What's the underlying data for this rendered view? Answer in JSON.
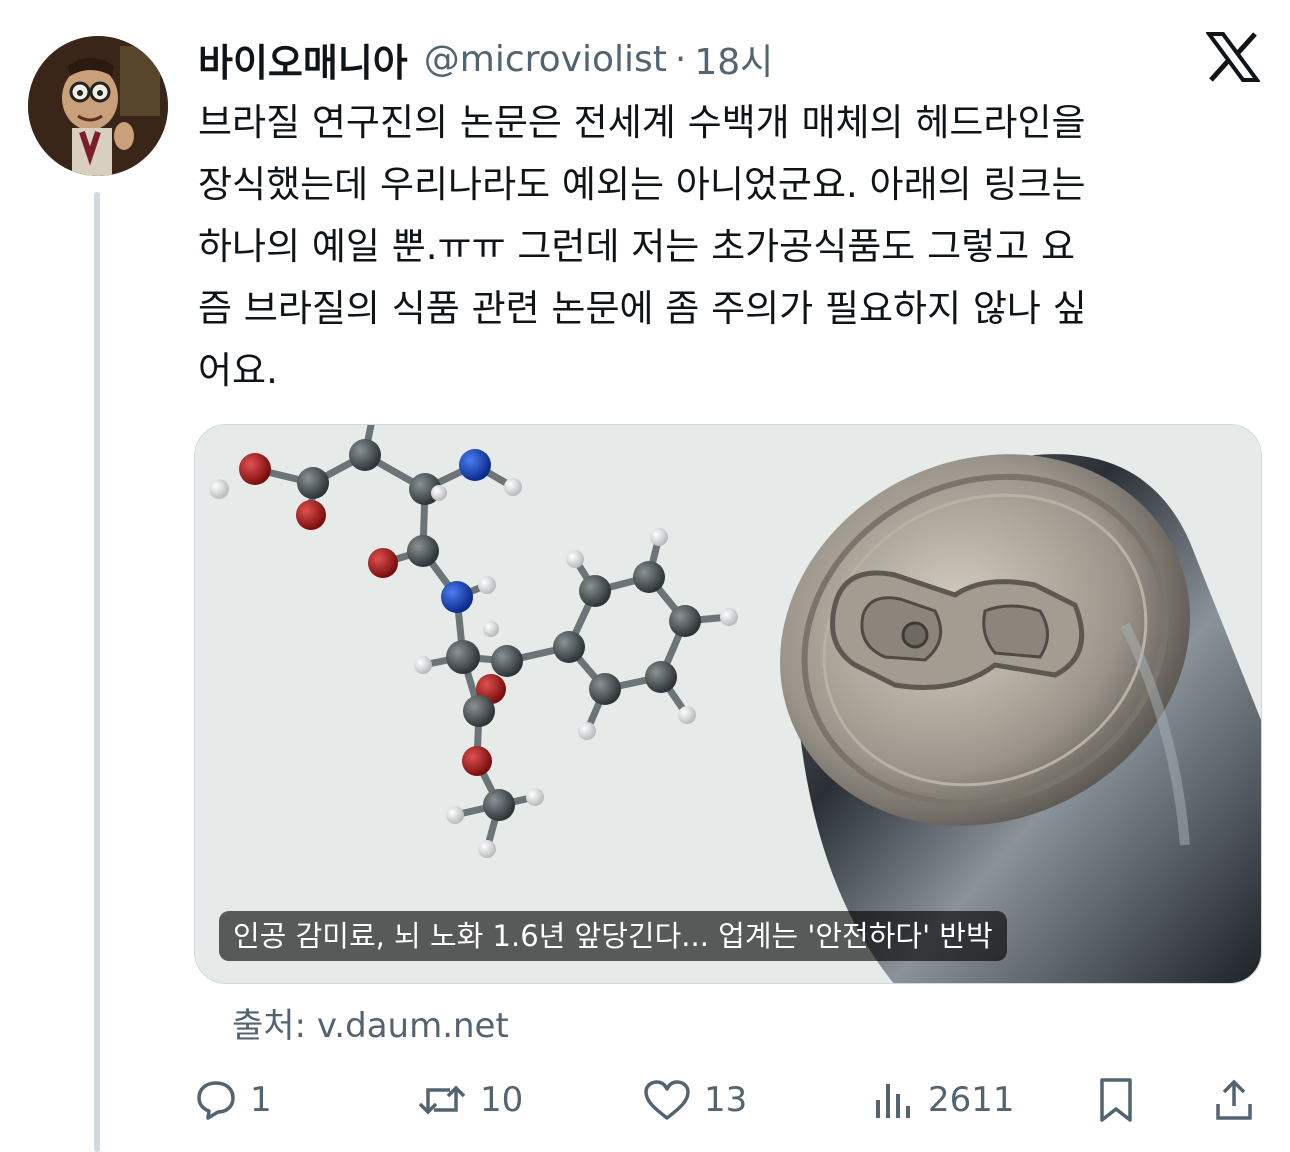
{
  "tweet": {
    "display_name": "바이오매니아",
    "handle": "@microviolist",
    "separator": "·",
    "time": "18시",
    "text_lines": [
      "브라질 연구진의 논문은 전세계 수백개 매체의 헤드라인을",
      "장식했는데 우리나라도 예외는 아니었군요. 아래의 링크는",
      "하나의 예일 뿐.ㅠㅠ 그런데 저는 초가공식품도 그렇고 요",
      "즘 브라질의 식품 관련 논문에 좀 주의가 필요하지 않나 싶",
      "어요."
    ]
  },
  "card": {
    "title": "인공 감미료, 뇌 노화 1.6년 앞당긴다... 업계는 '안전하다' 반박",
    "source": "출처: v.daum.net"
  },
  "actions": {
    "replies": "1",
    "retweets": "10",
    "likes": "13",
    "views": "2611"
  },
  "icons": {
    "platform_logo": "x-logo-icon",
    "reply": "reply-icon",
    "retweet": "retweet-icon",
    "like": "heart-icon",
    "views": "views-chart-icon",
    "bookmark": "bookmark-icon",
    "share": "share-icon"
  },
  "colors": {
    "text_primary": "#0f1419",
    "text_secondary": "#536471",
    "thread_line": "#cfd9de"
  }
}
